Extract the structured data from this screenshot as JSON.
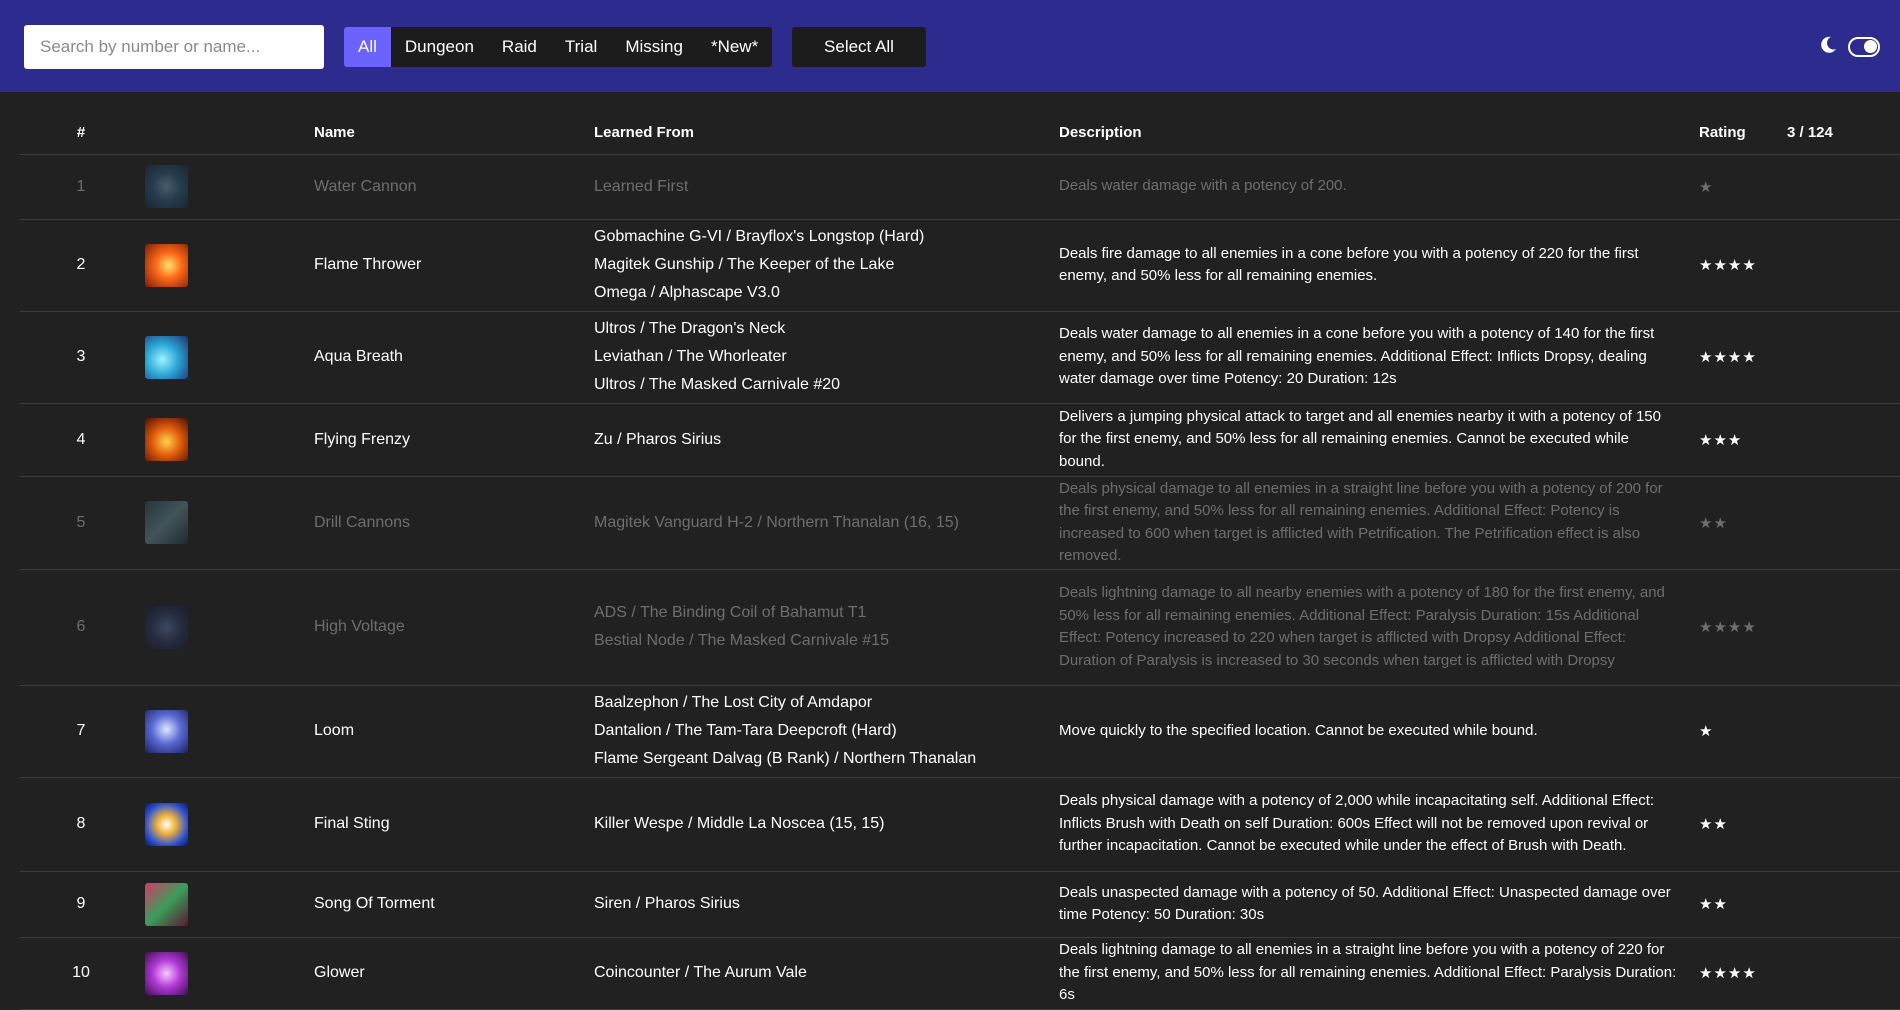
{
  "search": {
    "placeholder": "Search by number or name..."
  },
  "filters": [
    {
      "label": "All",
      "active": true
    },
    {
      "label": "Dungeon",
      "active": false
    },
    {
      "label": "Raid",
      "active": false
    },
    {
      "label": "Trial",
      "active": false
    },
    {
      "label": "Missing",
      "active": false
    },
    {
      "label": "*New*",
      "active": false
    }
  ],
  "select_all_label": "Select All",
  "theme": {
    "moon_icon": "moon-icon",
    "toggle_on": true
  },
  "colors": {
    "header_bg": "#2e2b8f",
    "active_filter": "#6c63ff",
    "page_bg": "#212121"
  },
  "table": {
    "headers": {
      "num": "#",
      "name": "Name",
      "from": "Learned From",
      "desc": "Description",
      "rating": "Rating",
      "count": "3 / 124"
    },
    "rows": [
      {
        "num": "1",
        "name": "Water Cannon",
        "from": [
          "Learned First"
        ],
        "desc": "Deals water damage with a potency of 200.",
        "rating": "★",
        "dim": true,
        "icon": "water-cannon-icon"
      },
      {
        "num": "2",
        "name": "Flame Thrower",
        "from": [
          "Gobmachine G-VI / Brayflox's Longstop (Hard)",
          "Magitek Gunship / The Keeper of the Lake",
          "Omega / Alphascape V3.0"
        ],
        "desc": "Deals fire damage to all enemies in a cone before you with a potency of 220 for the first enemy, and 50% less for all remaining enemies.",
        "rating": "★★★★",
        "dim": false,
        "icon": "flame-thrower-icon"
      },
      {
        "num": "3",
        "name": "Aqua Breath",
        "from": [
          "Ultros / The Dragon's Neck",
          "Leviathan / The Whorleater",
          "Ultros / The Masked Carnivale #20"
        ],
        "desc": "Deals water damage to all enemies in a cone before you with a potency of 140 for the first enemy, and 50% less for all remaining enemies. Additional Effect: Inflicts Dropsy, dealing water damage over time Potency: 20 Duration: 12s",
        "rating": "★★★★",
        "dim": false,
        "icon": "aqua-breath-icon"
      },
      {
        "num": "4",
        "name": "Flying Frenzy",
        "from": [
          "Zu / Pharos Sirius"
        ],
        "desc": "Delivers a jumping physical attack to target and all enemies nearby it with a potency of 150 for the first enemy, and 50% less for all remaining enemies. Cannot be executed while bound.",
        "rating": "★★★",
        "dim": false,
        "icon": "flying-frenzy-icon"
      },
      {
        "num": "5",
        "name": "Drill Cannons",
        "from": [
          "Magitek Vanguard H-2 / Northern Thanalan (16, 15)"
        ],
        "desc": "Deals physical damage to all enemies in a straight line before you with a potency of 200 for the first enemy, and 50% less for all remaining enemies. Additional Effect: Potency is increased to 600 when target is afflicted with Petrification. The Petrification effect is also removed.",
        "rating": "★★",
        "dim": true,
        "icon": "drill-cannons-icon"
      },
      {
        "num": "6",
        "name": "High Voltage",
        "from": [
          "ADS / The Binding Coil of Bahamut T1",
          "Bestial Node / The Masked Carnivale #15"
        ],
        "desc": "Deals lightning damage to all nearby enemies with a potency of 180 for the first enemy, and 50% less for all remaining enemies. Additional Effect: Paralysis Duration: 15s Additional Effect: Potency increased to 220 when target is afflicted with Dropsy Additional Effect: Duration of Paralysis is increased to 30 seconds when target is afflicted with Dropsy",
        "rating": "★★★★",
        "dim": true,
        "icon": "high-voltage-icon"
      },
      {
        "num": "7",
        "name": "Loom",
        "from": [
          "Baalzephon / The Lost City of Amdapor",
          "Dantalion / The Tam-Tara Deepcroft (Hard)",
          "Flame Sergeant Dalvag (B Rank) / Northern Thanalan"
        ],
        "desc": "Move quickly to the specified location. Cannot be executed while bound.",
        "rating": "★",
        "dim": false,
        "icon": "loom-icon"
      },
      {
        "num": "8",
        "name": "Final Sting",
        "from": [
          "Killer Wespe / Middle La Noscea (15, 15)"
        ],
        "desc": "Deals physical damage with a potency of 2,000 while incapacitating self. Additional Effect: Inflicts Brush with Death on self Duration: 600s Effect will not be removed upon revival or further incapacitation. Cannot be executed while under the effect of Brush with Death.",
        "rating": "★★",
        "dim": false,
        "icon": "final-sting-icon"
      },
      {
        "num": "9",
        "name": "Song Of Torment",
        "from": [
          "Siren / Pharos Sirius"
        ],
        "desc": "Deals unaspected damage with a potency of 50. Additional Effect: Unaspected damage over time Potency: 50 Duration: 30s",
        "rating": "★★",
        "dim": false,
        "icon": "song-of-torment-icon"
      },
      {
        "num": "10",
        "name": "Glower",
        "from": [
          "Coincounter / The Aurum Vale"
        ],
        "desc": "Deals lightning damage to all enemies in a straight line before you with a potency of 220 for the first enemy, and 50% less for all remaining enemies. Additional Effect: Paralysis Duration: 6s",
        "rating": "★★★★",
        "dim": false,
        "icon": "glower-icon"
      }
    ]
  }
}
